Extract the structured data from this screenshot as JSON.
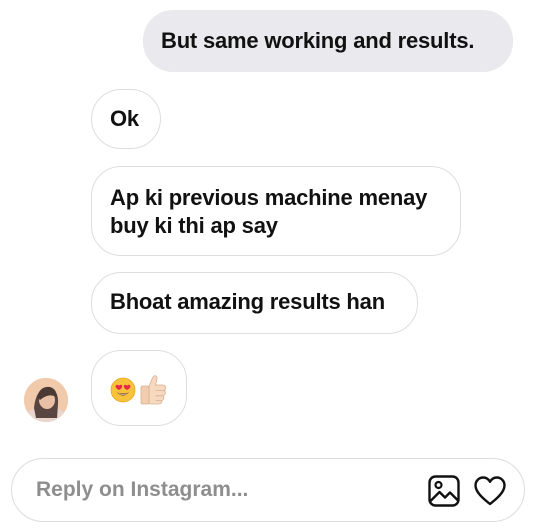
{
  "messages": [
    {
      "side": "sent",
      "text": "But same working and results."
    },
    {
      "side": "received",
      "text": "Ok"
    },
    {
      "side": "received",
      "lines": [
        "Ap ki previous machine menay",
        "buy ki thi ap say"
      ]
    },
    {
      "side": "received",
      "text": "Bhoat amazing results han"
    },
    {
      "side": "received",
      "emojis": [
        "heart-eyes-emoji",
        "thumbs-up-emoji"
      ]
    }
  ],
  "reply": {
    "placeholder": "Reply on Instagram..."
  },
  "icons": {
    "gallery": "image-gallery-icon",
    "like": "heart-icon"
  },
  "colors": {
    "sent_bubble": "#e9e9ee",
    "received_border": "#dedee0",
    "placeholder_text": "#8e8e8e"
  }
}
